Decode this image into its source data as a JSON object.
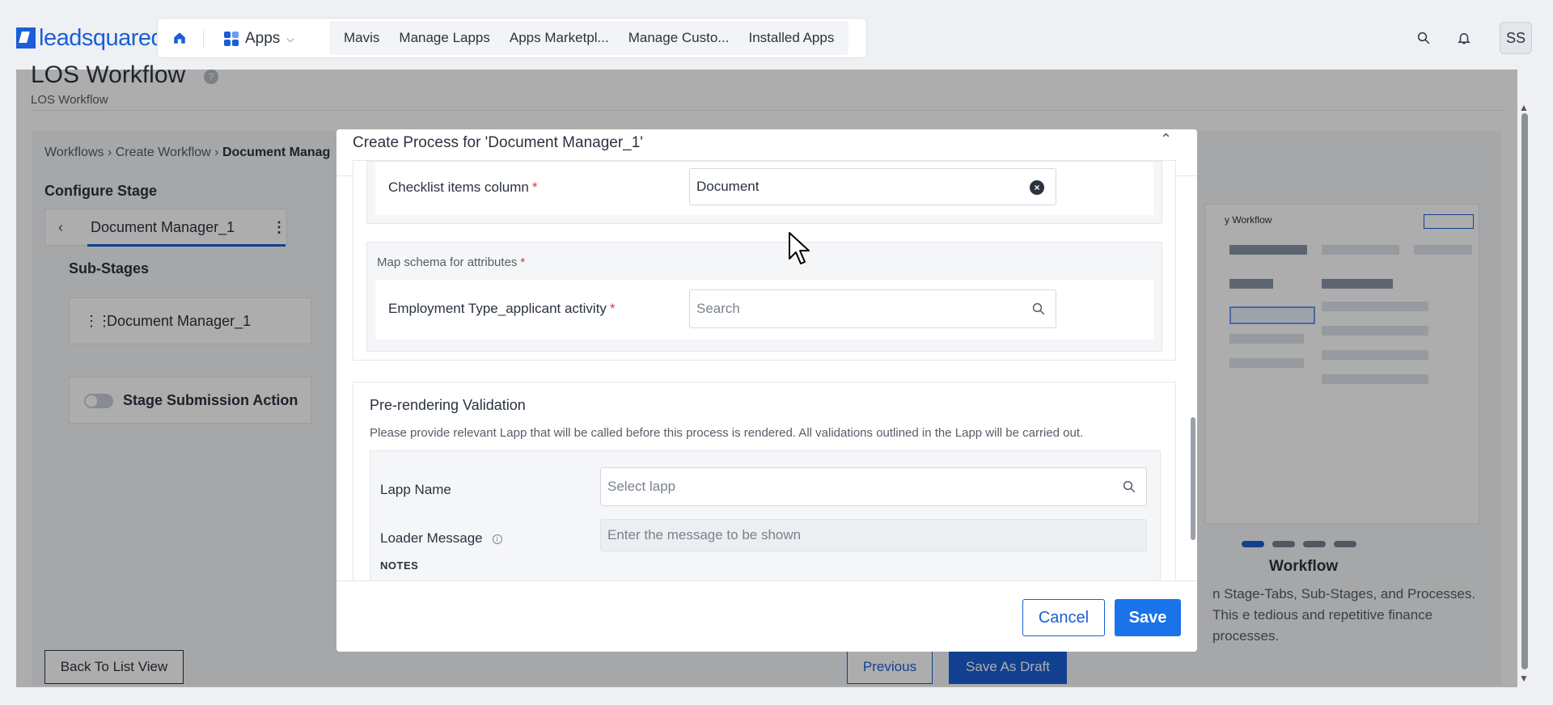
{
  "brand": {
    "name": "leadsquared",
    "color": "#1a5fd6"
  },
  "nav": {
    "apps_label": "Apps",
    "links": [
      "Mavis",
      "Manage Lapps",
      "Apps Marketpl...",
      "Manage Custo...",
      "Installed Apps"
    ],
    "avatar_initials": "SS"
  },
  "page": {
    "title": "LOS Workflow",
    "subtitle": "LOS Workflow",
    "breadcrumb": [
      "Workflows",
      "Create Workflow",
      "Document Manag"
    ],
    "configure_stage": "Configure Stage",
    "stage_tab": "Document Manager_1",
    "sub_stages_label": "Sub-Stages",
    "sub_stage_item": "Document Manager_1",
    "stage_submission_action": "Stage Submission Action",
    "back_to_list": "Back To List View",
    "previous": "Previous",
    "save_as_draft": "Save As Draft",
    "preview_title": "y Workflow",
    "carousel_title": "Workflow",
    "carousel_desc": "n Stage-Tabs, Sub-Stages, and Processes. This e tedious and repetitive finance processes."
  },
  "modal": {
    "title": "Create Process for 'Document Manager_1'",
    "checklist_label": "Checklist items column",
    "checklist_value": "Document",
    "map_schema_label": "Map schema for attributes",
    "employment_label": "Employment Type_applicant activity",
    "employment_placeholder": "Search",
    "prerender_title": "Pre-rendering Validation",
    "prerender_desc": "Please provide relevant Lapp that will be called before this process is rendered. All validations outlined in the Lapp will be carried out.",
    "lapp_name_label": "Lapp Name",
    "lapp_placeholder": "Select lapp",
    "loader_label": "Loader Message",
    "loader_placeholder": "Enter the message to be shown",
    "notes_label": "NOTES",
    "cancel": "Cancel",
    "save": "Save"
  },
  "colors": {
    "primary": "#1a5fd6",
    "required": "#d63b3b",
    "overlay": "rgba(0,0,0,0.32)"
  },
  "icons": [
    "home-icon",
    "apps-grid-icon",
    "chevron-down-icon",
    "search-icon",
    "bell-icon",
    "info-icon",
    "back-chevron-icon",
    "kebab-icon",
    "drag-handle-icon",
    "clear-icon",
    "chevron-up-icon",
    "cursor-icon"
  ]
}
